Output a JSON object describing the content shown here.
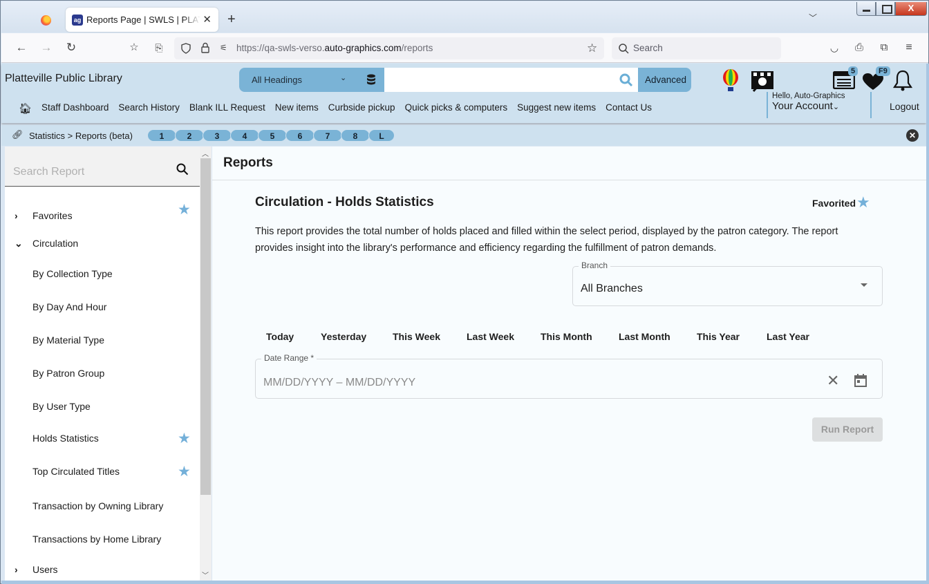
{
  "browser": {
    "tab_title": "Reports Page | SWLS | PLATT | Auto-Graphics",
    "tab_favicon": "ag",
    "url_prefix": "https://qa-swls-verso.",
    "url_domain": "auto-graphics.com",
    "url_path": "/reports",
    "search_placeholder": "Search",
    "window_close": "X"
  },
  "header": {
    "library_name": "Platteville Public Library",
    "search_scope": "All Headings",
    "search_value": "",
    "advanced_label": "Advanced",
    "list_badge": "5",
    "favorites_badge": "F9",
    "greeting": "Hello, Auto-Graphics",
    "account_label": "Your Account",
    "logout_label": "Logout",
    "nav": [
      "Staff Dashboard",
      "Search History",
      "Blank ILL Request",
      "New items",
      "Curbside pickup",
      "Quick picks & computers",
      "Suggest new items",
      "Contact Us"
    ]
  },
  "breadcrumb": {
    "text": "Statistics > Reports (beta)",
    "pills": [
      "1",
      "2",
      "3",
      "4",
      "5",
      "6",
      "7",
      "8",
      "L"
    ]
  },
  "sidebar": {
    "search_placeholder": "Search Report",
    "items": [
      {
        "label": "Favorites",
        "type": "group",
        "expanded": false,
        "starred": true
      },
      {
        "label": "Circulation",
        "type": "group",
        "expanded": true,
        "starred": false
      },
      {
        "label": "By Collection Type",
        "type": "report",
        "starred": false
      },
      {
        "label": "By Day And Hour",
        "type": "report",
        "starred": false
      },
      {
        "label": "By Material Type",
        "type": "report",
        "starred": false
      },
      {
        "label": "By Patron Group",
        "type": "report",
        "starred": false
      },
      {
        "label": "By User Type",
        "type": "report",
        "starred": false
      },
      {
        "label": "Holds Statistics",
        "type": "report",
        "starred": true
      },
      {
        "label": "Top Circulated Titles",
        "type": "report",
        "starred": true
      },
      {
        "label": "Transaction by Owning Library",
        "type": "report",
        "starred": false
      },
      {
        "label": "Transactions by Home Library",
        "type": "report",
        "starred": false
      },
      {
        "label": "Users",
        "type": "group",
        "expanded": false,
        "starred": false
      }
    ]
  },
  "main": {
    "page_title": "Reports",
    "report_title": "Circulation - Holds Statistics",
    "favorited_label": "Favorited",
    "description": "This report provides the total number of holds placed and filled within the select period, displayed by the patron category. The report provides insight into the library's performance and efficiency regarding the fulfillment of patron demands.",
    "branch_label": "Branch",
    "branch_value": "All Branches",
    "quick_ranges": [
      "Today",
      "Yesterday",
      "This Week",
      "Last Week",
      "This Month",
      "Last Month",
      "This Year",
      "Last Year"
    ],
    "date_range_label": "Date Range *",
    "date_range_placeholder": "MM/DD/YYYY – MM/DD/YYYY",
    "run_report_label": "Run Report"
  },
  "colors": {
    "accent": "#7ab3d6",
    "header_bg": "#cee1ef",
    "star": "#74b0d9"
  }
}
